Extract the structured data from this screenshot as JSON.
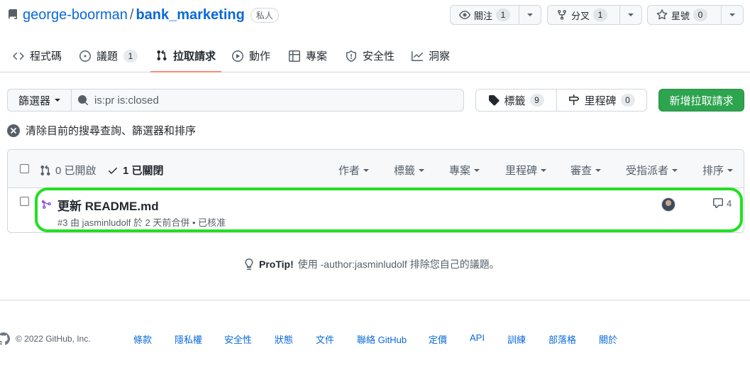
{
  "repo": {
    "owner": "george-boorman",
    "separator": "/",
    "name": "bank_marketing",
    "visibility": "私人"
  },
  "header_buttons": {
    "watch": {
      "label": "關注",
      "count": "1"
    },
    "fork": {
      "label": "分叉",
      "count": "1"
    },
    "star": {
      "label": "星號",
      "count": "0"
    }
  },
  "tabs": [
    {
      "label": "程式碼",
      "icon": "code-icon"
    },
    {
      "label": "議題",
      "icon": "issue-icon",
      "count": "1"
    },
    {
      "label": "拉取請求",
      "icon": "pull-request-icon",
      "active": true
    },
    {
      "label": "動作",
      "icon": "play-icon"
    },
    {
      "label": "專案",
      "icon": "table-icon"
    },
    {
      "label": "安全性",
      "icon": "shield-icon"
    },
    {
      "label": "洞察",
      "icon": "graph-icon"
    }
  ],
  "filters": {
    "filter_label": "篩選器",
    "search_value": "is:pr is:closed",
    "labels_label": "標籤",
    "labels_count": "9",
    "milestones_label": "里程碑",
    "milestones_count": "0",
    "new_pr_label": "新增拉取請求",
    "clear_text": "清除目前的搜尋查詢、篩選器和排序"
  },
  "list_header": {
    "open_text": "0 已開啟",
    "closed_text": "1 已關閉",
    "filters": [
      "作者",
      "標籤",
      "專案",
      "里程碑",
      "審查",
      "受指派者",
      "排序"
    ]
  },
  "pull_requests": [
    {
      "title": "更新 README.md",
      "meta": "#3 由 jasminludolf 於 2 天前合併 • 已核准",
      "comments": "4"
    }
  ],
  "protip": {
    "bold": "ProTip!",
    "text": "使用 -author:jasminludolf 排除您自己的議題。"
  },
  "footer": {
    "copyright": "© 2022 GitHub, Inc.",
    "links": [
      "條款",
      "隱私權",
      "安全性",
      "狀態",
      "文件",
      "聯絡 GitHub",
      "定價",
      "API",
      "訓練",
      "部落格",
      "關於"
    ]
  },
  "colors": {
    "link": "#0969da",
    "primary_button": "#2da44e",
    "merged": "#8250df",
    "active_tab_underline": "#fd8c73",
    "highlight": "#21e021"
  }
}
